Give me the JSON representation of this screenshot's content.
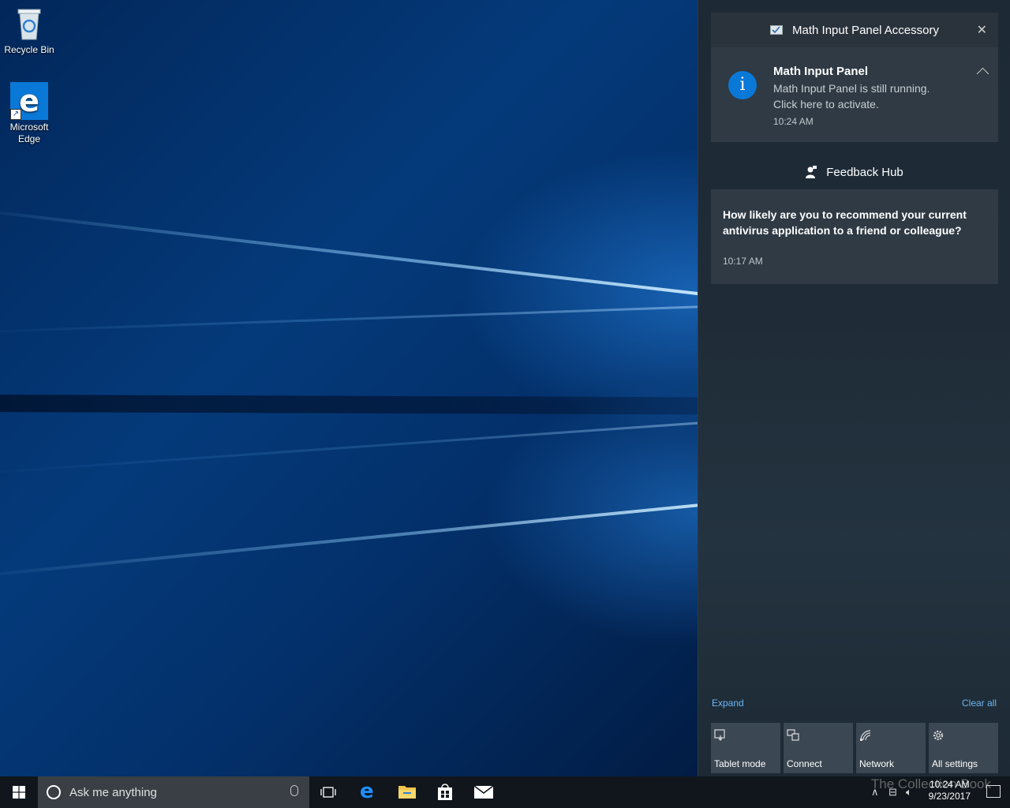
{
  "desktop": {
    "icons": [
      {
        "label": "Recycle Bin"
      },
      {
        "label_line1": "Microsoft",
        "label_line2": "Edge"
      }
    ]
  },
  "action_center": {
    "groups": {
      "math": {
        "app_name": "Math Input Panel Accessory",
        "notification": {
          "title": "Math Input Panel",
          "body_line1": "Math Input Panel is still running.",
          "body_line2": "Click here to activate.",
          "time": "10:24 AM"
        }
      },
      "feedback": {
        "app_name": "Feedback Hub",
        "notification": {
          "message": "How likely are you to recommend your current antivirus application to a friend or colleague?",
          "time": "10:17 AM"
        }
      }
    },
    "expand_label": "Expand",
    "clear_all_label": "Clear all",
    "quick_actions": [
      {
        "label": "Tablet mode",
        "icon": "tablet-mode-icon"
      },
      {
        "label": "Connect",
        "icon": "connect-icon"
      },
      {
        "label": "Network",
        "icon": "network-icon"
      },
      {
        "label": "All settings",
        "icon": "gear-icon"
      }
    ]
  },
  "taskbar": {
    "search_placeholder": "Ask me anything",
    "clock_time": "10:24 AM",
    "clock_date": "9/23/2017",
    "watermark": "The Collection Book"
  },
  "colors": {
    "accent": "#0a78d7",
    "link": "#6ab6f7",
    "card": "#2f3a44"
  }
}
